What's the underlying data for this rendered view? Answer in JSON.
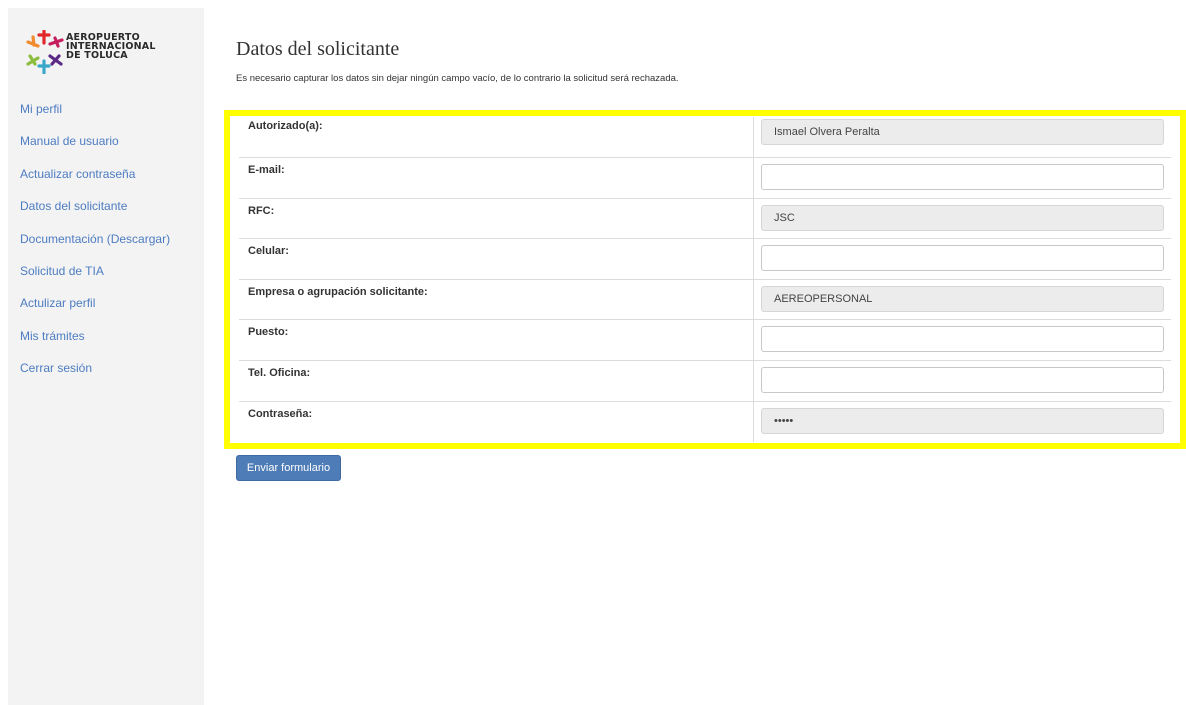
{
  "logo": {
    "line1": "AEROPUERTO",
    "line2": "INTERNACIONAL",
    "line3": "DE TOLUCA"
  },
  "sidebar": {
    "items": [
      {
        "label": "Mi perfil"
      },
      {
        "label": "Manual de usuario"
      },
      {
        "label": "Actualizar contraseña"
      },
      {
        "label": "Datos del solicitante"
      },
      {
        "label": "Documentación (Descargar)"
      },
      {
        "label": "Solicitud de TIA"
      },
      {
        "label": "Actulizar perfil"
      },
      {
        "label": "Mis trámites"
      },
      {
        "label": "Cerrar sesión"
      }
    ]
  },
  "main": {
    "title": "Datos del solicitante",
    "subtitle": "Es necesario capturar los datos sin dejar ningún campo vacío, de lo contrario la solicitud será rechazada.",
    "fields": [
      {
        "label": "Autorizado(a):",
        "value": "Ismael Olvera Peralta"
      },
      {
        "label": "E-mail:",
        "value": ""
      },
      {
        "label": "RFC:",
        "value": "JSC"
      },
      {
        "label": "Celular:",
        "value": ""
      },
      {
        "label": "Empresa o agrupación solicitante:",
        "value": "AEREOPERSONAL"
      },
      {
        "label": "Puesto:",
        "value": ""
      },
      {
        "label": "Tel. Oficina:",
        "value": ""
      },
      {
        "label": "Contraseña:",
        "value": "•••••"
      }
    ],
    "submit_label": "Enviar formulario"
  },
  "colors": {
    "link": "#4d7cc2",
    "button": "#4e7cb6",
    "highlight": "#ffff00",
    "sidebar_bg": "#f3f3f3"
  },
  "icons": {
    "logo": "airport-logo-icon"
  }
}
